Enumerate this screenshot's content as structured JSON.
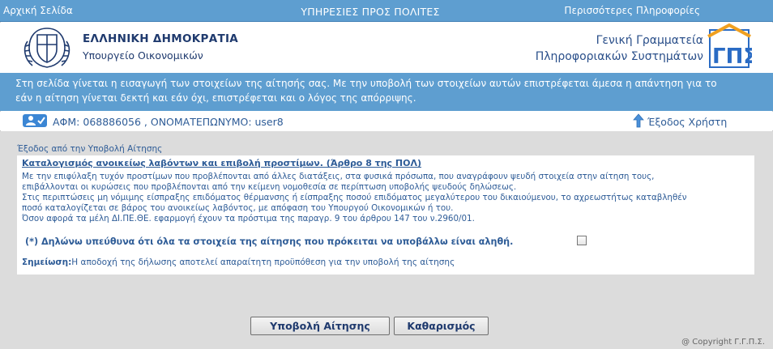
{
  "topbar": {
    "home": "Αρχική Σελίδα",
    "center": "ΥΠΗΡΕΣΙΕΣ ΠΡΟΣ ΠΟΛΙΤΕΣ",
    "more": "Περισσότερες Πληροφορίες"
  },
  "header": {
    "title": "ΕΛΛΗΝΙΚΗ ΔΗΜΟΚΡΑΤΙΑ",
    "subtitle": "Υπουργείο Οικονομικών",
    "gg_line1": "Γενική Γραμματεία",
    "gg_line2": "Πληροφοριακών Συστημάτων"
  },
  "banner": {
    "line1": "Στη σελίδα γίνεται η εισαγωγή των στοιχείων της αίτησής σας. Με την υποβολή των στοιχείων αυτών επιστρέφεται άμεσα η απάντηση για το",
    "line2": "εάν η αίτηση γίνεται δεκτή και εάν όχι, επιστρέφεται και ο λόγος της απόρριψης."
  },
  "user": {
    "info": "ΑΦΜ: 068886056 , ΟΝΟΜΑΤΕΠΩΝΥΜΟ: user8",
    "exit": "Έξοδος Χρήστη"
  },
  "main": {
    "back_link": "Έξοδος από την Υποβολή Αίτησης",
    "heading": "Καταλογισμός ανοικείως λαβόντων και επιβολή προστίμων. (Άρθρο 8 της ΠΟΛ)",
    "paragraphs": [
      "Με την επιφύλαξη τυχόν προστίμων που προβλέπονται από άλλες διατάξεις, στα φυσικά πρόσωπα, που αναγράφουν ψευδή στοιχεία στην αίτηση τους,",
      "επιβάλλονται οι κυρώσεις που προβλέπονται από την κείμενη νομοθεσία σε περίπτωση υποβολής ψευδούς δηλώσεως.",
      "Στις περιπτώσεις μη νόμιμης είσπραξης επιδόματος θέρμανσης ή είσπραξης ποσού επιδόματος μεγαλύτερου του δικαιούμενου, το αχρεωστήτως καταβληθέν",
      "ποσό καταλογίζεται σε βάρος του ανοικείως λαβόντος, με απόφαση του Υπουργού Οικονομικών ή του.",
      "Όσον αφορά τα μέλη ΔΙ.ΠΕ.ΘΕ. εφαρμογή έχουν τα πρόστιμα της παραγρ. 9 του άρθρου 147 του ν.2960/01."
    ],
    "declaration": "(*) Δηλώνω υπεύθυνα ότι όλα τα στοιχεία της αίτησης που πρόκειται να υποβάλλω είναι αληθή.",
    "declaration_checked": false,
    "note_label": "Σημείωση:",
    "note_text": "Η αποδοχή της δήλωσης αποτελεί απαραίτητη προϋπόθεση για την υποβολή της αίτησης"
  },
  "buttons": {
    "submit": "Υποβολή Αίτησης",
    "clear": "Καθαρισμός"
  },
  "footer": {
    "copyright": "@ Copyright Γ.Γ.Π.Σ."
  },
  "colors": {
    "accent_bar": "#5e9ed0",
    "panel_bg": "#dcdcdc",
    "text_blue": "#2e5c97"
  }
}
